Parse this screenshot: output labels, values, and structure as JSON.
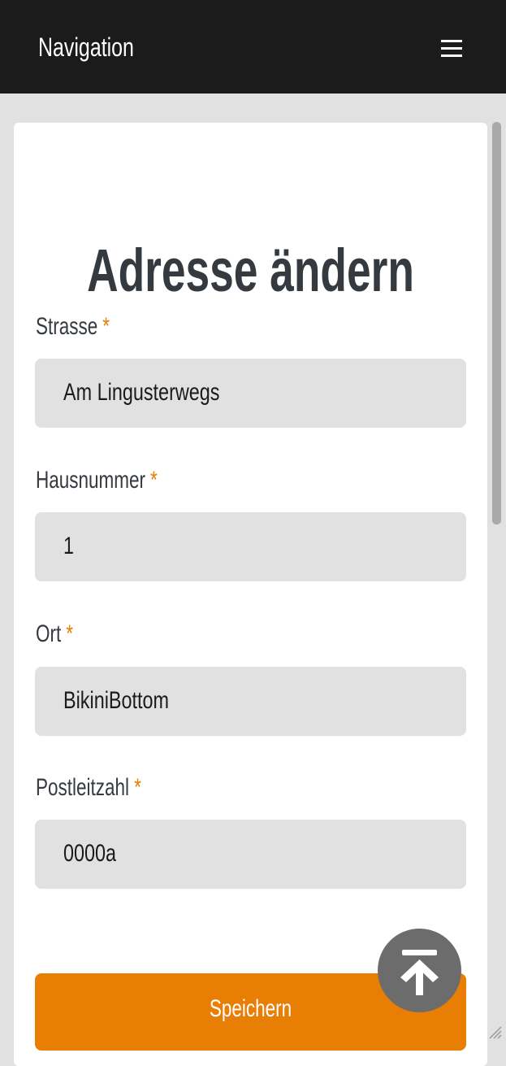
{
  "navbar": {
    "brand": "Navigation",
    "menu_icon": "hamburger-menu-icon"
  },
  "form": {
    "title": "Adresse ändern",
    "required_marker": "*",
    "fields": [
      {
        "label": "Strasse",
        "value": "Am Lingusterwegs"
      },
      {
        "label": "Hausnummer",
        "value": "1"
      },
      {
        "label": "Ort",
        "value": "BikiniBottom"
      },
      {
        "label": "Postleitzahl",
        "value": "0000a"
      }
    ],
    "submit_label": "Speichern"
  },
  "scroll_top_icon": "arrow-up-to-top-icon",
  "colors": {
    "navbar_bg": "#1b1b1b",
    "page_bg": "#e1e1e1",
    "accent": "#e87e04",
    "title_text": "#343a40",
    "scroll_top_bg": "#6c6c6c"
  }
}
